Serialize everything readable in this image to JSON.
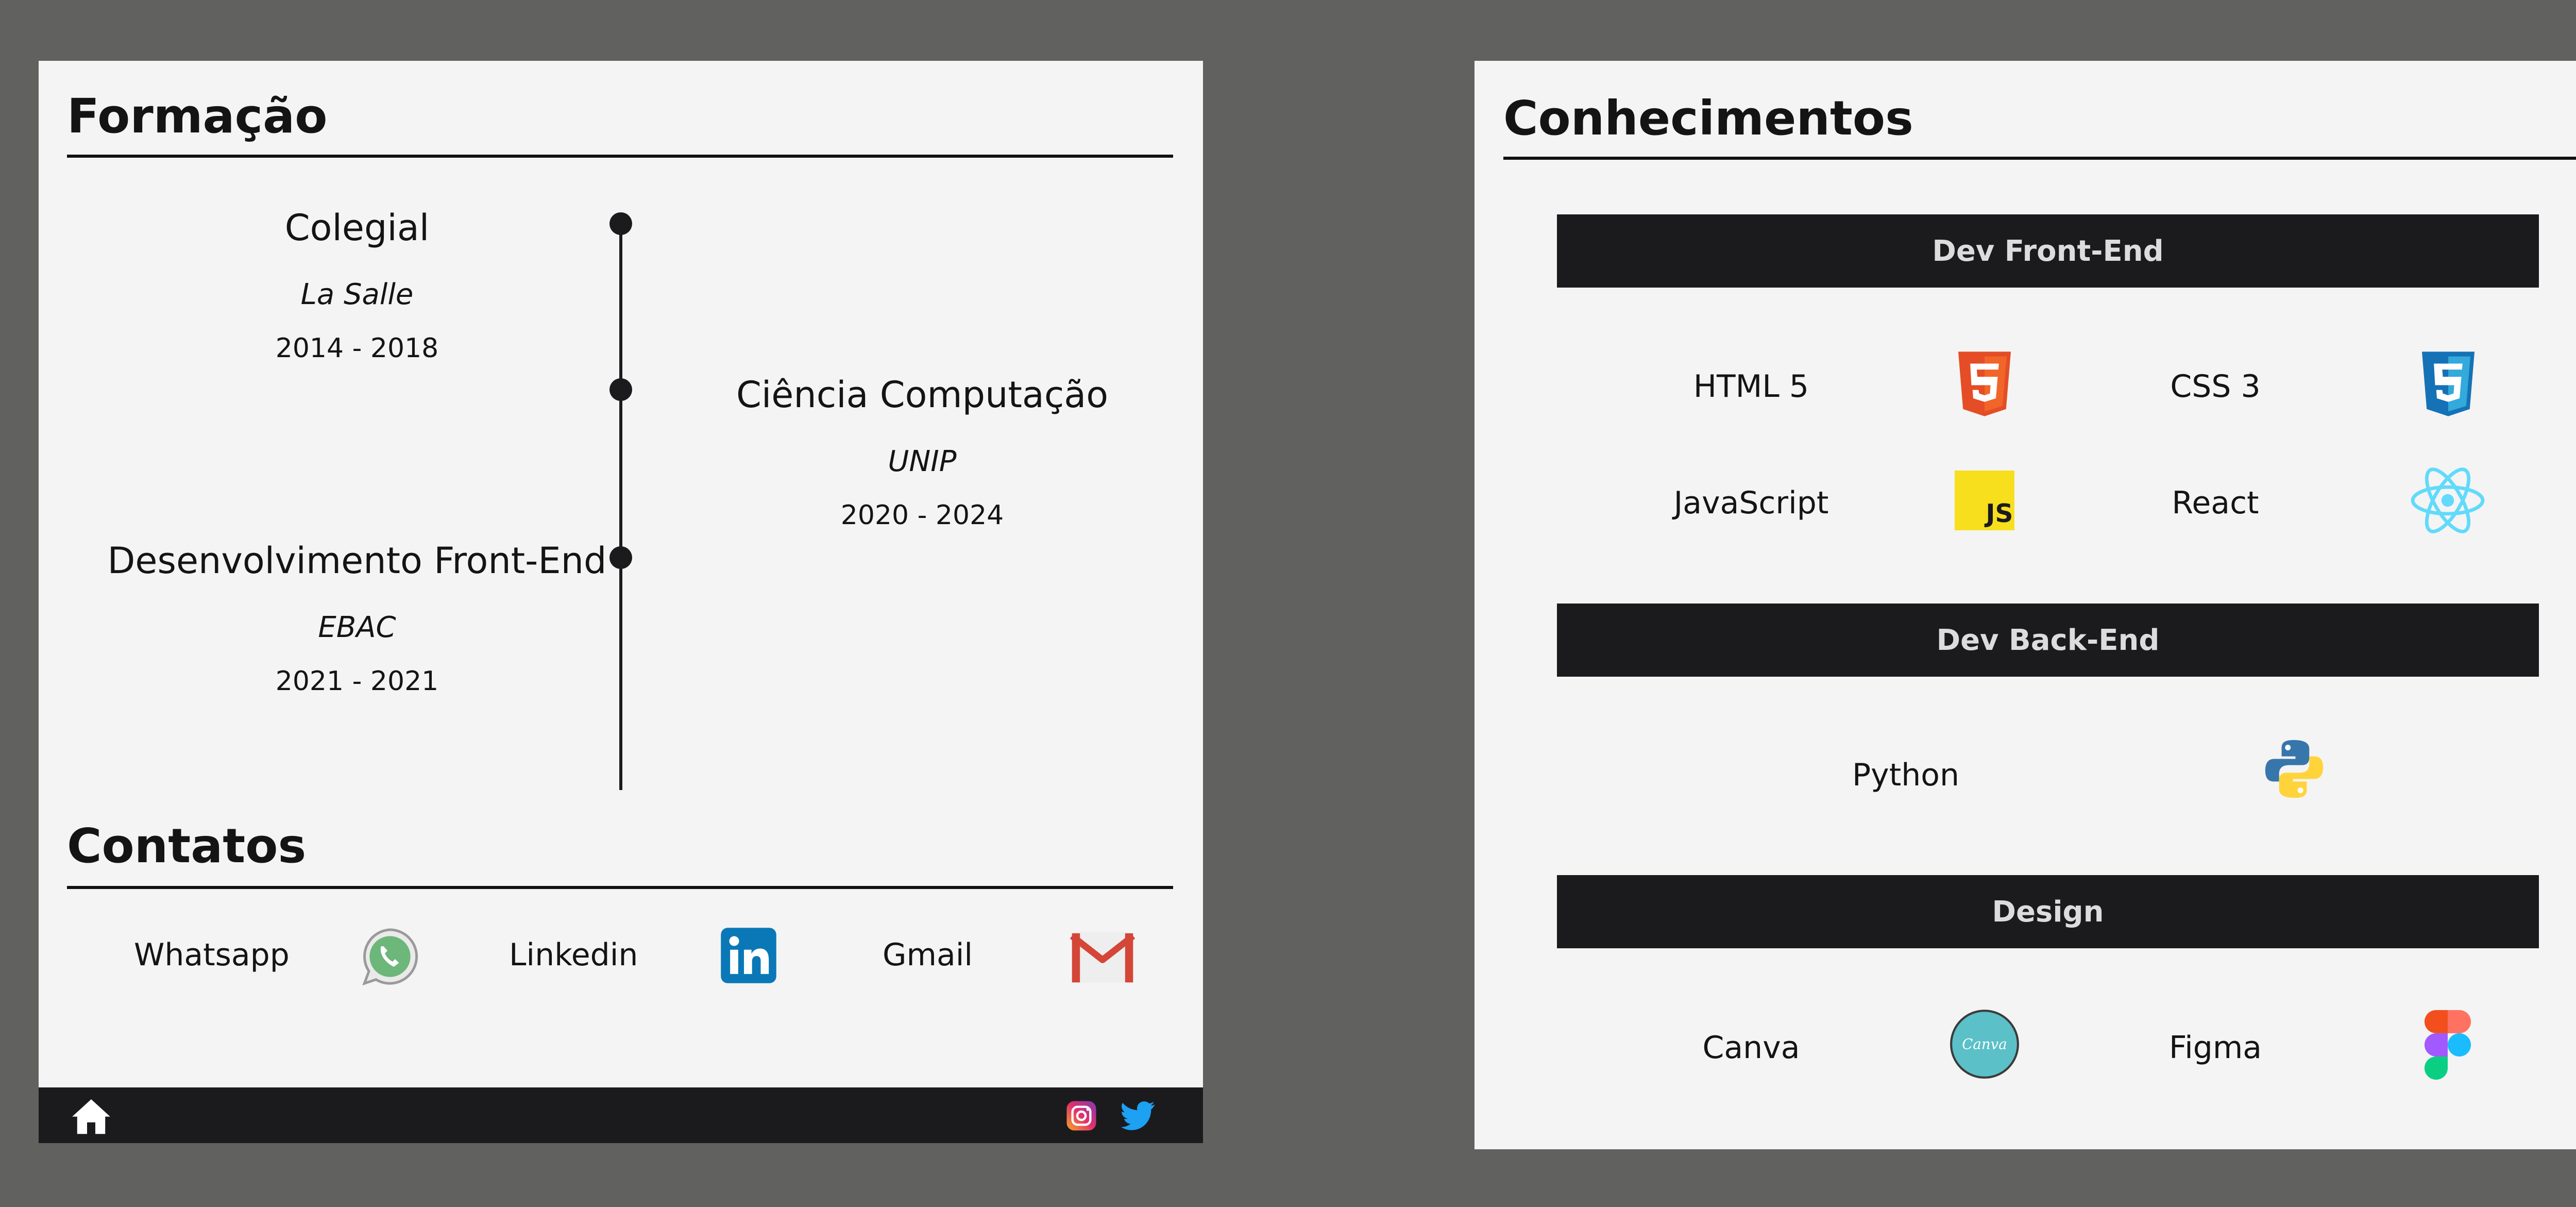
{
  "education": {
    "title": "Formação",
    "items": [
      {
        "course": "Colegial",
        "school": "La Salle",
        "years": "2014 - 2018"
      },
      {
        "course": "Ciência Computação",
        "school": "UNIP",
        "years": "2020 - 2024"
      },
      {
        "course": "Desenvolvimento Front-End",
        "school": "EBAC",
        "years": "2021 - 2021"
      }
    ]
  },
  "contacts": {
    "title": "Contatos",
    "items": [
      {
        "label": "Whatsapp",
        "icon": "whatsapp-icon"
      },
      {
        "label": "Linkedin",
        "icon": "linkedin-icon"
      },
      {
        "label": "Gmail",
        "icon": "gmail-icon"
      }
    ]
  },
  "footer": {
    "left_icon": "home-icon",
    "right_icons": [
      "instagram-icon",
      "twitter-icon"
    ]
  },
  "skills": {
    "title": "Conhecimentos",
    "groups": [
      {
        "name": "Dev Front-End",
        "items": [
          {
            "label": "HTML 5",
            "icon": "html5-icon"
          },
          {
            "label": "CSS 3",
            "icon": "css3-icon"
          },
          {
            "label": "JavaScript",
            "icon": "javascript-icon"
          },
          {
            "label": "React",
            "icon": "react-icon"
          }
        ]
      },
      {
        "name": "Dev Back-End",
        "items": [
          {
            "label": "Python",
            "icon": "python-icon"
          }
        ]
      },
      {
        "name": "Design",
        "items": [
          {
            "label": "Canva",
            "icon": "canva-icon"
          },
          {
            "label": "Figma",
            "icon": "figma-icon"
          }
        ]
      }
    ]
  },
  "colors": {
    "page_background": "#616160",
    "panel_background": "#f4f4f4",
    "dark_bar": "#1b1b1e",
    "bar_text": "#dcdcdc"
  }
}
